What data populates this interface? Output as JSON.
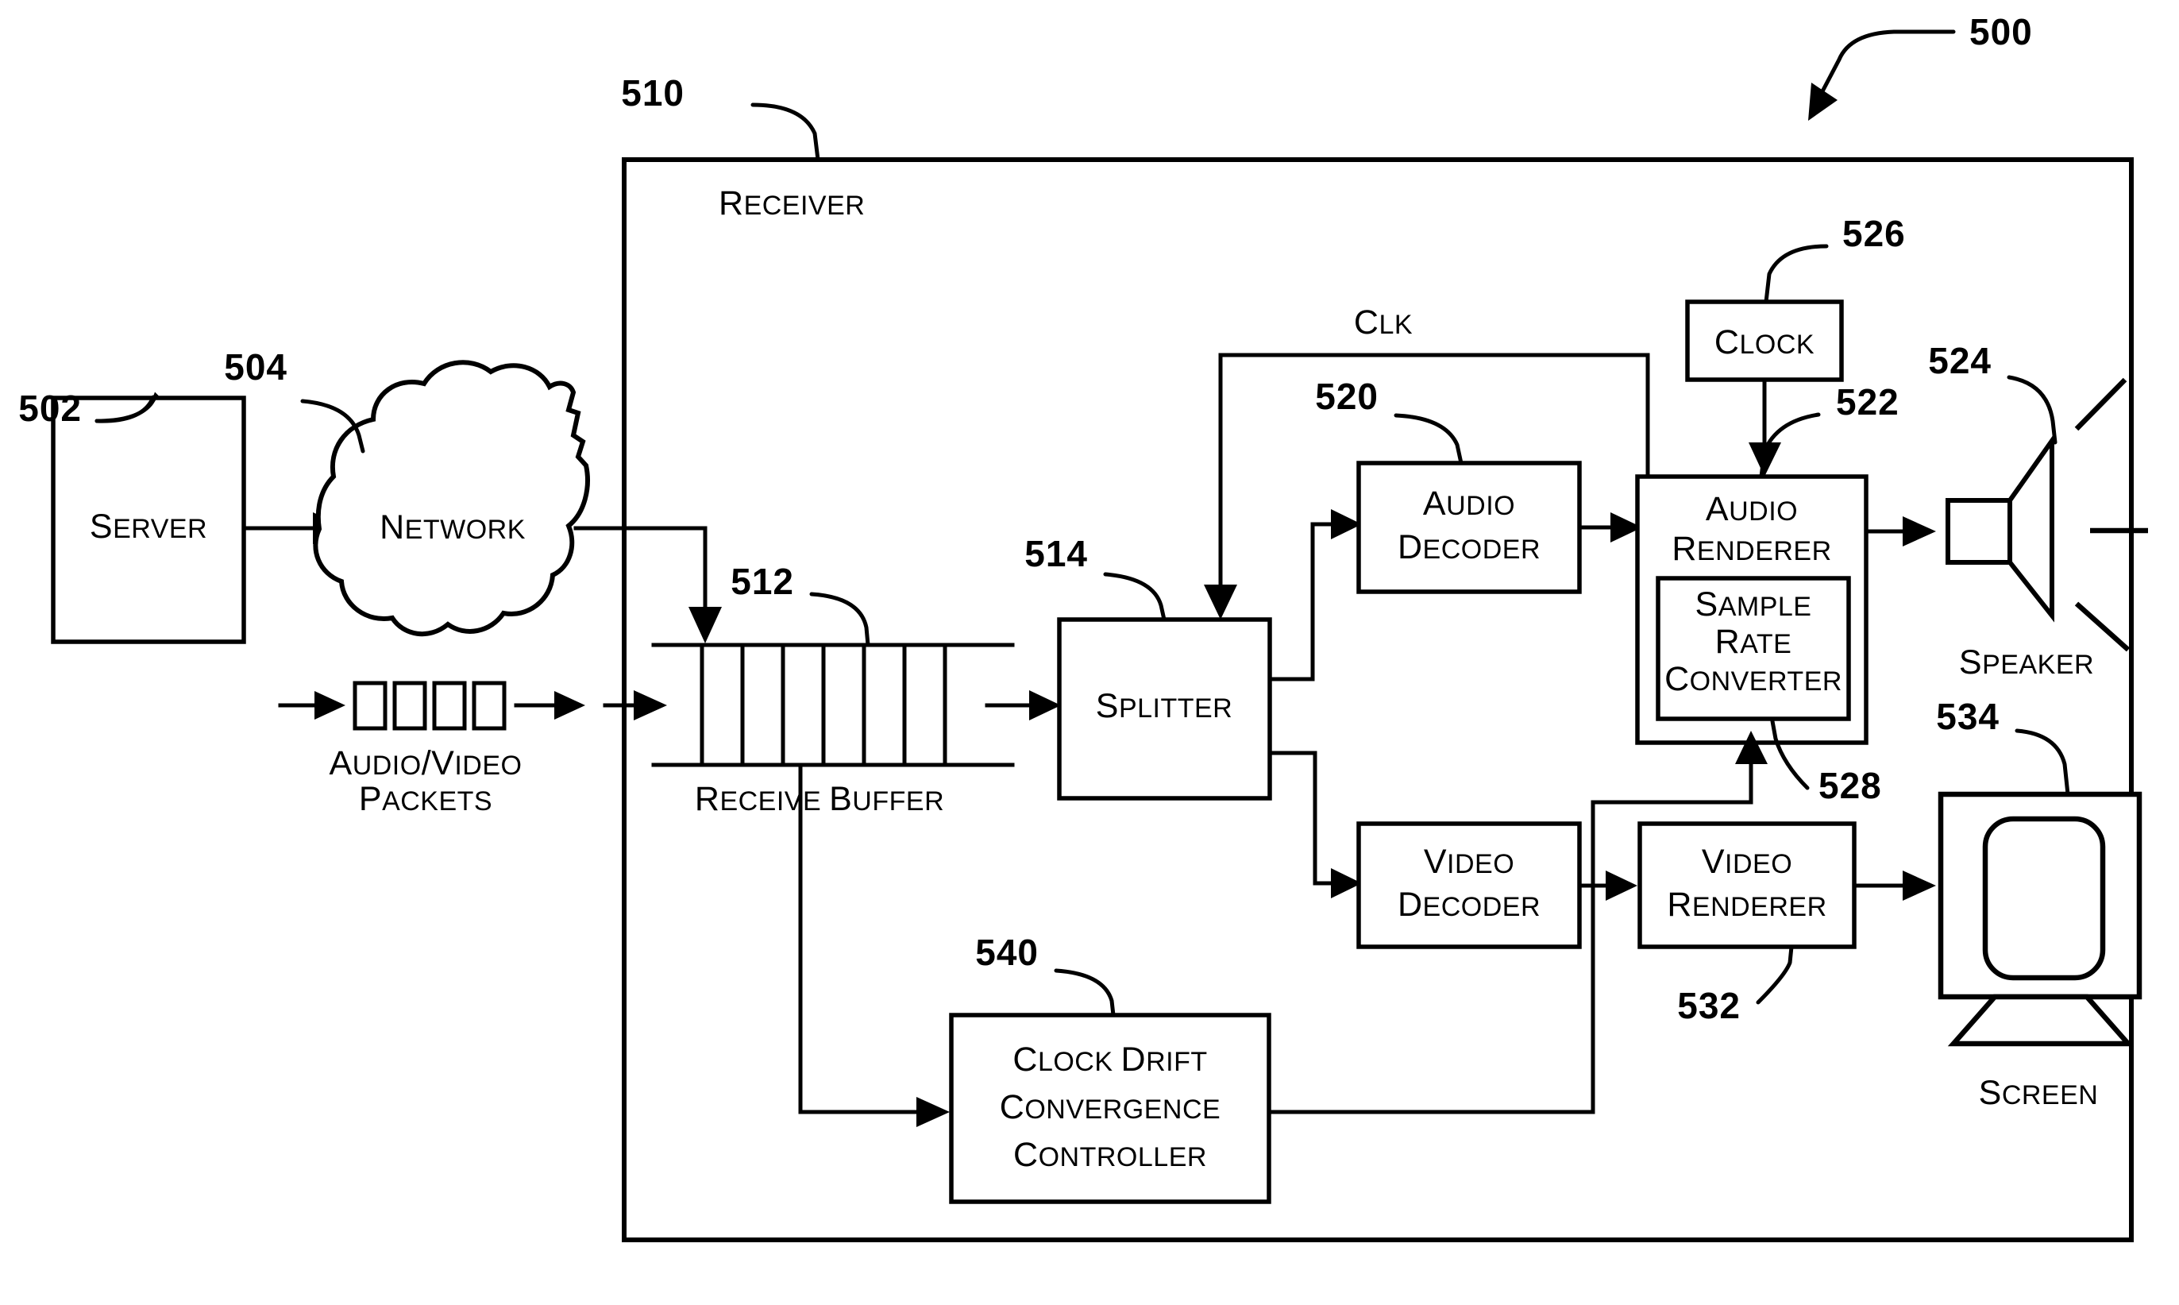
{
  "figure": {
    "number": "500",
    "title_ref": "500"
  },
  "refs": {
    "server": "502",
    "network": "504",
    "receiver": "510",
    "receive_buffer": "512",
    "splitter": "514",
    "audio_decoder": "520",
    "audio_renderer": "522",
    "speaker": "524",
    "clock": "526",
    "sample_rate_converter": "528",
    "video_renderer": "532",
    "screen": "534",
    "clock_drift_controller": "540",
    "figure": "500"
  },
  "blocks": {
    "server": {
      "label": "Server",
      "cap": "S",
      "rest": "ERVER"
    },
    "network": {
      "label": "Network",
      "cap": "N",
      "rest": "ETWORK"
    },
    "receiver": {
      "label": "Receiver",
      "cap": "R",
      "rest": "ECEIVER"
    },
    "receive_buffer": {
      "label": "Receive Buffer",
      "cells": 7
    },
    "splitter": {
      "label": "Splitter",
      "cap": "S",
      "rest": "PLITTER"
    },
    "audio_decoder": {
      "line1": "Audio",
      "line2": "Decoder"
    },
    "video_decoder": {
      "line1": "Video",
      "line2": "Decoder"
    },
    "audio_renderer": {
      "line1": "Audio",
      "line2": "Renderer"
    },
    "video_renderer": {
      "line1": "Video",
      "line2": "Renderer"
    },
    "sample_rate_converter": {
      "line1": "Sample",
      "line2": "Rate",
      "line3": "Converter"
    },
    "clock": {
      "label": "Clock",
      "cap": "C",
      "rest": "LOCK"
    },
    "clock_drift": {
      "line1": "Clock Drift",
      "line2": "Convergence",
      "line3": "Controller"
    },
    "speaker": {
      "label": "Speaker",
      "cap": "S",
      "rest": "PEAKER"
    },
    "screen": {
      "label": "Screen",
      "cap": "S",
      "rest": "CREEN"
    }
  },
  "annotations": {
    "packets_line1": "Audio/Video",
    "packets_line2": "Packets",
    "clk_signal": "Clk",
    "receive_buffer_line1": "Receive Buffer"
  },
  "colors": {
    "ink": "#000000",
    "paper": "#ffffff"
  }
}
